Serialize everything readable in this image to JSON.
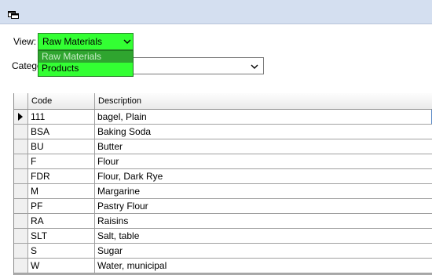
{
  "window": {
    "title_icon": "form-icon"
  },
  "filters": {
    "view_label": "View:",
    "view_value": "Raw Materials",
    "category_label": "Catego",
    "category_value": ""
  },
  "view_dropdown": {
    "options": [
      "Raw Materials",
      "Products"
    ],
    "highlighted_index": 0
  },
  "grid": {
    "columns": [
      "Code",
      "Description"
    ],
    "rows": [
      {
        "code": "111",
        "description": "bagel, Plain"
      },
      {
        "code": "BSA",
        "description": "Baking Soda"
      },
      {
        "code": "BU",
        "description": "Butter"
      },
      {
        "code": "F",
        "description": "Flour"
      },
      {
        "code": "FDR",
        "description": "Flour, Dark Rye"
      },
      {
        "code": "M",
        "description": "Margarine"
      },
      {
        "code": "PF",
        "description": "Pastry Flour"
      },
      {
        "code": "RA",
        "description": "Raisins"
      },
      {
        "code": "SLT",
        "description": "Salt, table"
      },
      {
        "code": "S",
        "description": "Sugar"
      },
      {
        "code": "W",
        "description": "Water, municipal"
      }
    ],
    "current_row": 0
  },
  "colors": {
    "dropdown_bg": "#33ff33",
    "dropdown_selected": "#2fa52f",
    "titlebar": "#d4dff0"
  }
}
